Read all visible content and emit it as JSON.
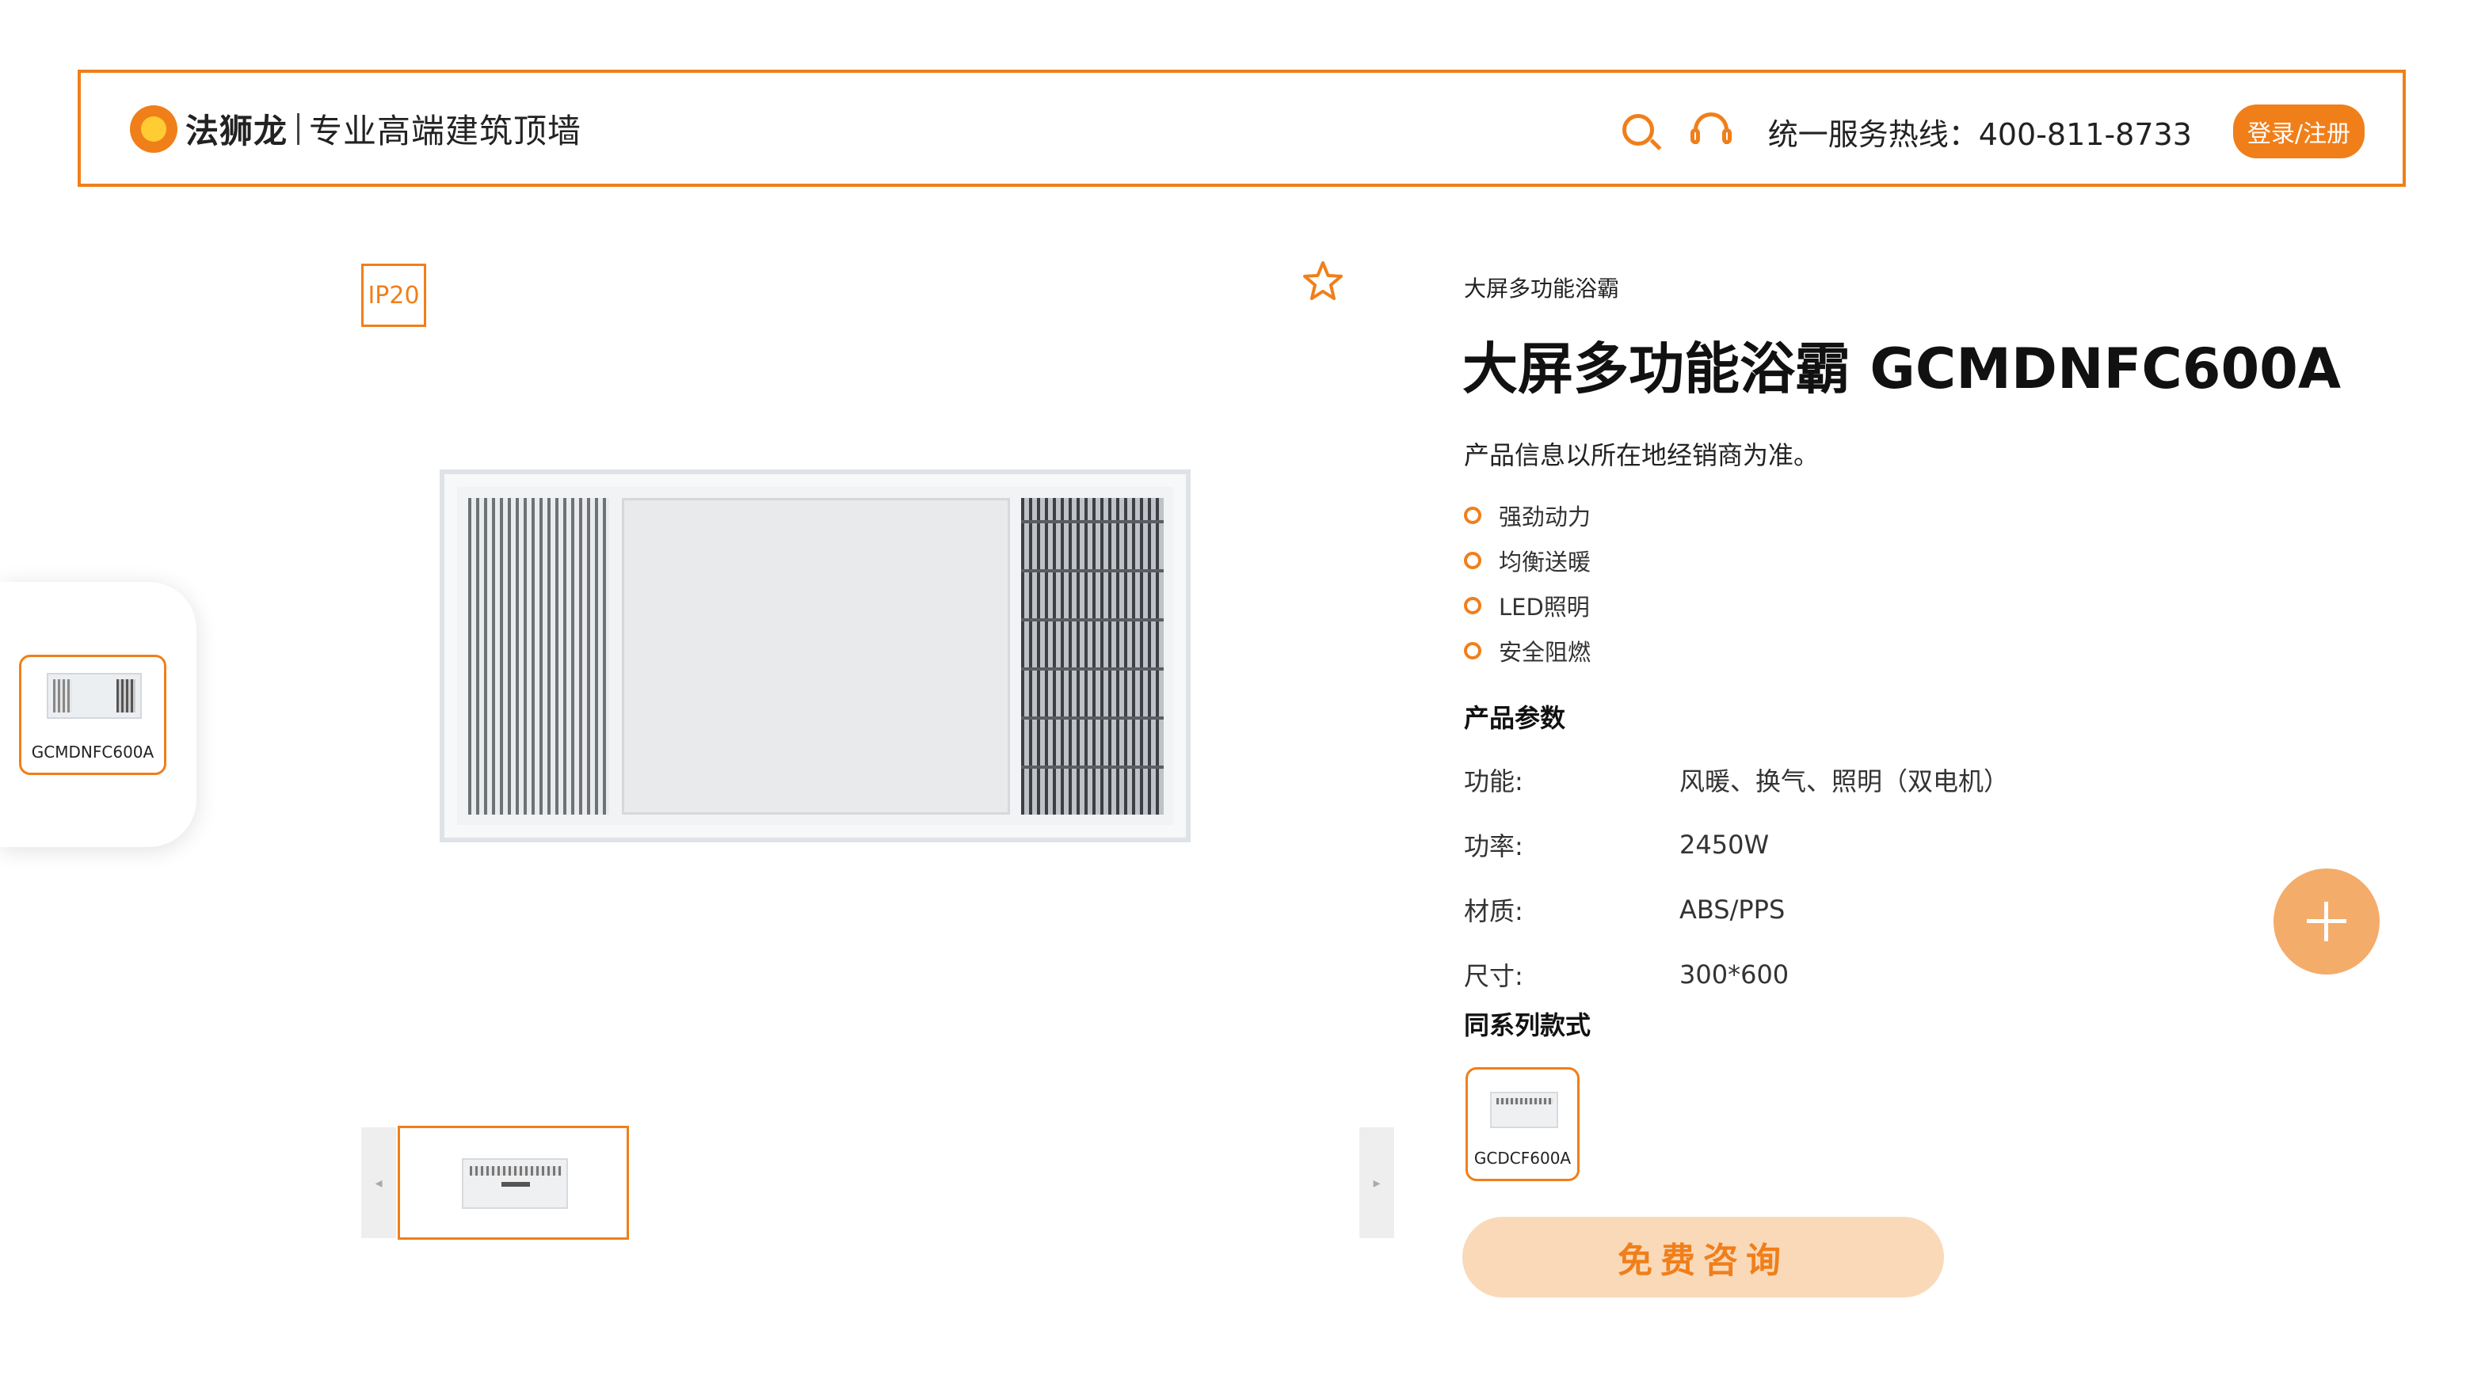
{
  "header": {
    "brand": "法狮龙",
    "slogan": "专业高端建筑顶墙",
    "hotline": "统一服务热线：400-811-8733",
    "login_label": "登录/注册",
    "icons": [
      "lion-logo-icon",
      "search-icon",
      "headset-icon"
    ]
  },
  "sidebar_panel": {
    "item_label": "GCMDNFC600A"
  },
  "gallery": {
    "ip_badge": "IP20",
    "icons": [
      "star-icon",
      "chevron-left-icon",
      "chevron-right-icon"
    ],
    "prev_arrow": "◂",
    "next_arrow": "▸"
  },
  "product": {
    "breadcrumb": "大屏多功能浴霸",
    "title": "大屏多功能浴霸 GCMDNFC600A",
    "note": "产品信息以所在地经销商为准。",
    "features": [
      "强劲动力",
      "均衡送暖",
      "LED照明",
      "安全阻燃"
    ],
    "params_title": "产品参数",
    "params": [
      {
        "key": "功能:",
        "value": "风暖、换气、照明（双电机）"
      },
      {
        "key": "功率:",
        "value": "2450W"
      },
      {
        "key": "材质:",
        "value": "ABS/PPS"
      },
      {
        "key": "尺寸:",
        "value": "300*600"
      }
    ],
    "series_title": "同系列款式",
    "series": [
      {
        "label": "GCDCF600A"
      }
    ],
    "consult_label": "免费咨询"
  },
  "colors": {
    "accent": "#f07f1a",
    "consult_bg": "#fad9b9",
    "fab": "#f4ac6a"
  },
  "fab_icon": "plus-icon"
}
